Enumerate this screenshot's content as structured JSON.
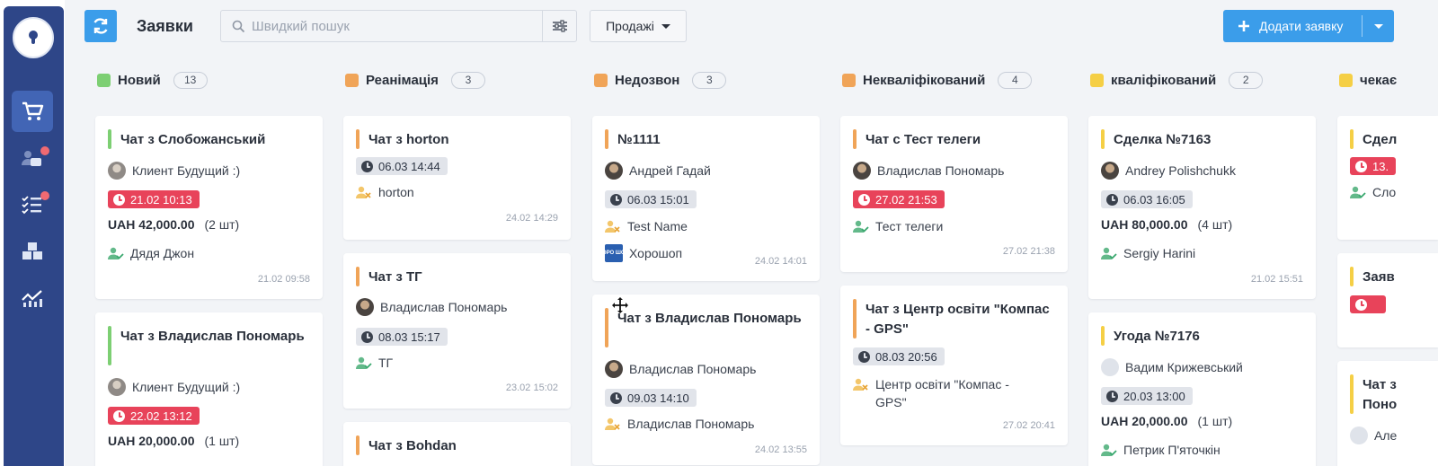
{
  "app": {
    "page_title": "Заявки"
  },
  "search": {
    "placeholder": "Швидкий пошук",
    "value": ""
  },
  "toolbar": {
    "pipeline_label": "Продажі",
    "add_label": "Додати заявку"
  },
  "sidebar": {
    "items": [
      {
        "name": "cart-icon",
        "active": true,
        "dot": false
      },
      {
        "name": "users-chat-icon",
        "active": false,
        "dot": true
      },
      {
        "name": "tasks-icon",
        "active": false,
        "dot": true
      },
      {
        "name": "boxes-icon",
        "active": false,
        "dot": false
      },
      {
        "name": "analytics-icon",
        "active": false,
        "dot": false
      }
    ]
  },
  "colors": {
    "green": "#7dcf73",
    "orange": "#f0a458",
    "yellow": "#f5cf45",
    "red": "#e8435a",
    "blue": "#3b9dea",
    "sidebar": "#2e4688"
  },
  "columns": [
    {
      "name": "Новий",
      "count": "13",
      "cards": [
        {
          "title": "Чат з Слобожанський",
          "client": "Клиент Будущий :)",
          "date": "21.02 10:13",
          "date_overdue": true,
          "amount": "UAH 42,000.00",
          "qty": "(2 шт)",
          "manager": "Дядя Джон",
          "created": "21.02 09:58"
        },
        {
          "title": "Чат з Владислав Пономарь",
          "client": "Клиент Будущий :)",
          "date": "22.02 13:12",
          "date_overdue": true,
          "amount": "UAH 20,000.00",
          "qty": "(1 шт)"
        }
      ]
    },
    {
      "name": "Реанімація",
      "count": "3",
      "cards": [
        {
          "title": "Чат з horton",
          "date": "06.03 14:44",
          "manager": "horton",
          "created": "24.02 14:29"
        },
        {
          "title": "Чат з ТГ",
          "client": "Владислав Пономарь",
          "date": "08.03 15:17",
          "manager": "ТГ",
          "created": "23.02 15:02"
        },
        {
          "title": "Чат з Bohdan"
        }
      ]
    },
    {
      "name": "Недозвон",
      "count": "3",
      "cards": [
        {
          "title": "№1111",
          "client": "Андрей Гадай",
          "date": "06.03 15:01",
          "manager": "Test Name",
          "source_logo": "ХОРО ШОП",
          "source": "Хорошоп",
          "created": "24.02 14:01"
        },
        {
          "title": "Чат з Владислав Пономарь",
          "client": "Владислав Пономарь",
          "date": "09.03 14:10",
          "manager": "Владислав Пономарь",
          "created": "24.02 13:55"
        }
      ]
    },
    {
      "name": "Некваліфікований",
      "count": "4",
      "cards": [
        {
          "title": "Чат с Тест телеги",
          "client": "Владислав Пономарь",
          "date": "27.02 21:53",
          "date_overdue": true,
          "manager": "Тест телеги",
          "created": "27.02 21:38"
        },
        {
          "title": "Чат з Центр освіти \"Компас - GPS\"",
          "date": "08.03 20:56",
          "manager": "Центр освіти \"Компас - GPS\"",
          "created": "27.02 20:41"
        }
      ]
    },
    {
      "name": "кваліфікований",
      "count": "2",
      "cards": [
        {
          "title": "Сделка №7163",
          "client": "Andrey Polishchukk",
          "date": "06.03 16:05",
          "amount": "UAH 80,000.00",
          "qty": "(4 шт)",
          "manager": "Sergiy Harini",
          "created": "21.02 15:51"
        },
        {
          "title": "Угода №7176",
          "client": "Вадим Крижевський",
          "date": "20.03 13:00",
          "amount": "UAH 20,000.00",
          "qty": "(1 шт)",
          "manager": "Петрик П'яточкін"
        }
      ]
    },
    {
      "name": "чекає",
      "cards": [
        {
          "title": "Сдел",
          "date": "13.",
          "date_overdue": true,
          "manager": "Сло"
        },
        {
          "title": "Заяв"
        },
        {
          "title": "Чат з Поно",
          "client": "Але"
        }
      ]
    }
  ]
}
